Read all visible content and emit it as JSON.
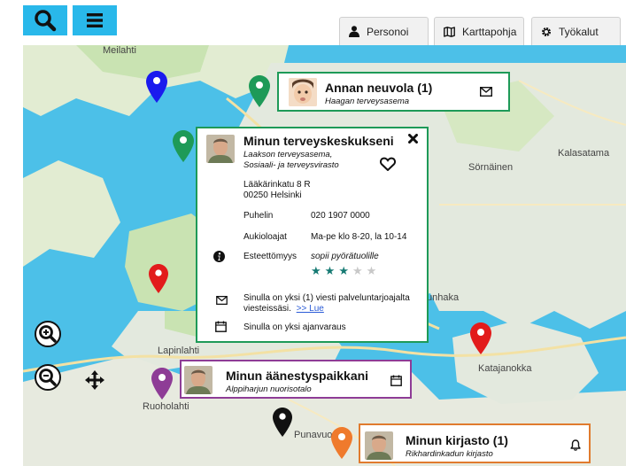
{
  "toolbar": {
    "search_icon": "search-icon",
    "menu_icon": "hamburger-menu-icon",
    "personalize_label": "Personoi",
    "basemap_label": "Karttapohja",
    "tools_label": "Työkalut"
  },
  "map": {
    "places": {
      "meilahti": "Meilahti",
      "kalasatama": "Kalasatama",
      "sornainen": "Sörnäinen",
      "lapinlahti": "Lapinlahti",
      "ruoholahti": "Ruoholahti",
      "katajanokka": "Katajanokka",
      "punavuori": "Punavuo",
      "kruununhaka": "unhaka"
    }
  },
  "cards": {
    "neuvola": {
      "title": "Annan neuvola  (1)",
      "subtitle": "Haagan terveysasema",
      "action_icon": "envelope-icon",
      "color": "#1e9a58"
    },
    "terveys": {
      "title": "Minun terveyskeskukseni",
      "subtitle1": "Laakson terveysasema,",
      "subtitle2": "Sosiaali- ja terveysvirasto",
      "address1": "Lääkärinkatu 8 R",
      "address2": "00250 Helsinki",
      "phone_label": "Puhelin",
      "phone_value": "020  1907 0000",
      "hours_label": "Aukioloajat",
      "hours_value": "Ma-pe klo 8-20, la 10-14",
      "access_label": "Esteettömyys",
      "access_value": "sopii pyörätuolille",
      "rating": 3,
      "rating_max": 5,
      "message_line1": "Sinulla on yksi (1) viesti palveluntarjoajalta",
      "message_line2": "viesteissäsi.",
      "message_link": ">> Lue",
      "appointment": "Sinulla on yksi ajanvaraus",
      "color": "#1e9a58"
    },
    "aanestys": {
      "title": "Minun äänestyspaikkani",
      "subtitle": "Alppiharjun nuorisotalo",
      "action_icon": "calendar-icon",
      "color": "#8e3c96"
    },
    "kirjasto": {
      "title": "Minun kirjasto (1)",
      "subtitle": "Rikhardinkadun kirjasto",
      "action_icon": "bell-icon",
      "color": "#e07b2e"
    }
  },
  "pins": {
    "blue": "#1a1aee",
    "green": "#1e9a58",
    "red": "#e21b1b",
    "purple": "#8e3c96",
    "black": "#111111",
    "orange": "#ef7a2c"
  }
}
